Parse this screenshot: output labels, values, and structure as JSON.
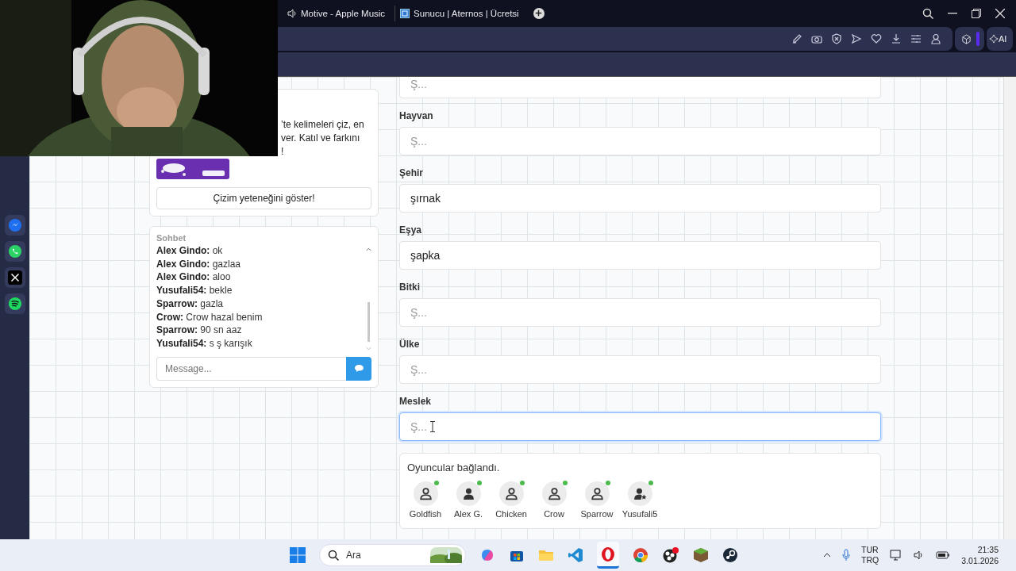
{
  "browser": {
    "tabs": [
      {
        "title": "Motive - Apple Music",
        "audio": true,
        "selected": false
      },
      {
        "title": "Sunucu | Aternos | Ücretsi",
        "audio": false,
        "selected": false
      }
    ],
    "ai_label": "AI"
  },
  "intro": {
    "lines": [
      "’te kelimeleri çiz, en",
      "ver. Katıl ve farkını",
      "!"
    ],
    "button": "Çizim yeteneğini göster!"
  },
  "chat": {
    "title": "Sohbet",
    "messages": [
      {
        "name": "Alex Gindo:",
        "text": "ok"
      },
      {
        "name": "Alex Gindo:",
        "text": "gazlaa"
      },
      {
        "name": "Alex Gindo:",
        "text": "aloo"
      },
      {
        "name": "Yusufali54:",
        "text": "bekle"
      },
      {
        "name": "Sparrow:",
        "text": "gazla"
      },
      {
        "name": "Crow:",
        "text": "Crow hazal benim"
      },
      {
        "name": "Sparrow:",
        "text": "90 sn aaz"
      },
      {
        "name": "Yusufali54:",
        "text": "s ş karışık"
      }
    ],
    "placeholder": "Message..."
  },
  "fields": [
    {
      "placeholder": "Ş...",
      "focused": false
    },
    {
      "label": "Hayvan",
      "placeholder": "Ş...",
      "focused": false
    },
    {
      "label": "Şehir",
      "value": "şırnak",
      "focused": false
    },
    {
      "label": "Eşya",
      "value": "şapka",
      "focused": false
    },
    {
      "label": "Bitki",
      "placeholder": "Ş...",
      "focused": false
    },
    {
      "label": "Ülke",
      "placeholder": "Ş...",
      "focused": false
    },
    {
      "label": "Meslek",
      "placeholder": "Ş...",
      "focused": true
    }
  ],
  "players": {
    "status": "Oyuncular bağlandı.",
    "list": [
      {
        "name": "Goldfish",
        "kind": "guest",
        "online": true
      },
      {
        "name": "Alex G.",
        "kind": "member",
        "online": true
      },
      {
        "name": "Chicken",
        "kind": "guest",
        "online": true
      },
      {
        "name": "Crow",
        "kind": "guest",
        "online": true
      },
      {
        "name": "Sparrow",
        "kind": "guest",
        "online": true
      },
      {
        "name": "Yusufali5",
        "kind": "host",
        "online": true
      }
    ]
  },
  "taskbar": {
    "search": "Ara",
    "lang": [
      "TUR",
      "TRQ"
    ],
    "time": "21:35",
    "date": "3.01.2026"
  }
}
